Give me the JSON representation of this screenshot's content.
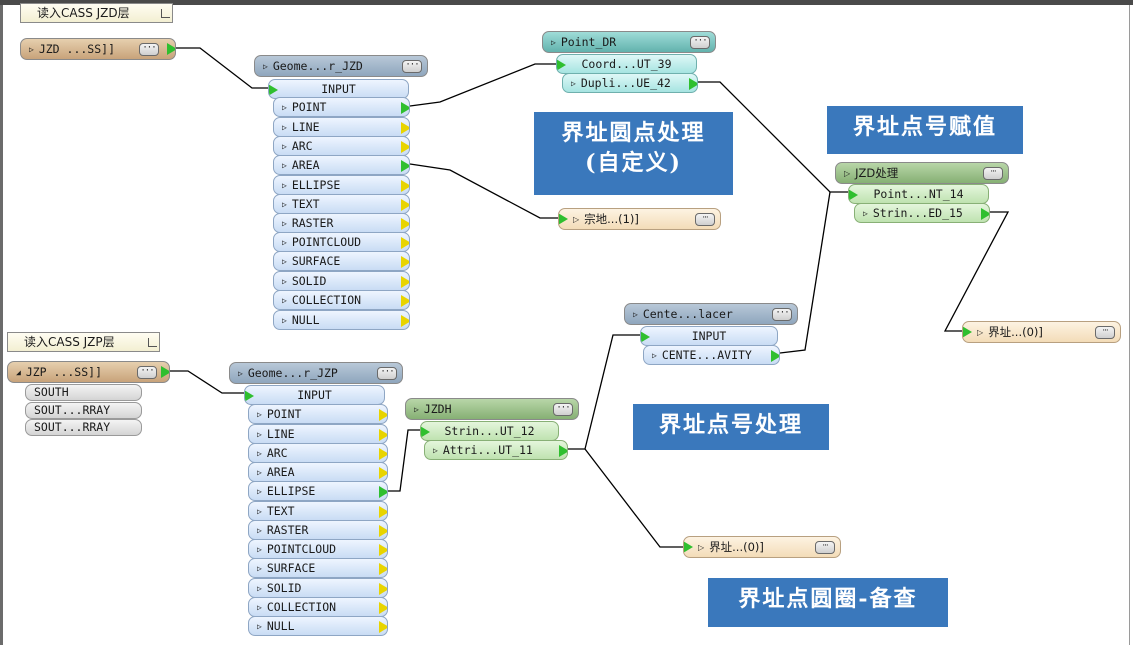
{
  "bookmarks": {
    "jzd": "读入CASS JZD层",
    "jzp": "读入CASS JZP层"
  },
  "sources": {
    "jzd_reader": "JZD ...SS]]",
    "jzp_reader": "JZP ...SS]]",
    "jzp_attrs": [
      "SOUTH",
      "SOUT...RRAY",
      "SOUT...RRAY"
    ]
  },
  "filters": {
    "jzd": {
      "title": "Geome...r_JZD"
    },
    "jzp": {
      "title": "Geome...r_JZP"
    },
    "ports": [
      "INPUT",
      "POINT",
      "LINE",
      "ARC",
      "AREA",
      "ELLIPSE",
      "TEXT",
      "RASTER",
      "POINTCLOUD",
      "SURFACE",
      "SOLID",
      "COLLECTION",
      "NULL"
    ]
  },
  "point_dr": {
    "title": "Point_DR",
    "out1": "Coord...UT_39",
    "out2": "Dupli...UE_42"
  },
  "jzd_proc": {
    "title": "JZD处理",
    "out1": "Point...NT_14",
    "out2": "Strin...ED_15"
  },
  "jzdh": {
    "title": "JZDH",
    "out1": "Strin...UT_12",
    "out2": "Attri...UT_11"
  },
  "center": {
    "title": "Cente...lacer",
    "input": "INPUT",
    "out": "CENTE...AVITY"
  },
  "writers": {
    "zongdi": "宗地...(1)]",
    "jiezhi1": "界址...(0)]",
    "jiezhi2": "界址...(0)]"
  },
  "notes": {
    "n1_line1": "界址圆点处理",
    "n1_line2": "(自定义)",
    "n2": "界址点号赋值",
    "n3": "界址点号处理",
    "n4": "界址点圆圈-备查"
  },
  "icons": {
    "expand": "triangle-right-icon",
    "collapse": "triangle-down-icon",
    "more": "ellipsis-icon"
  },
  "colors": {
    "wire": "#000000",
    "port_green": "#2fbf2f",
    "port_yellow": "#e8d400",
    "note_bg": "#3a78bc"
  }
}
